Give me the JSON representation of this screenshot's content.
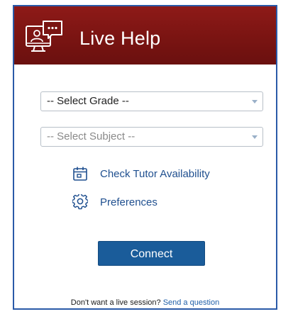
{
  "header": {
    "title": "Live Help",
    "icon": "live-help-chat-icon",
    "background_color": "#7a1412"
  },
  "form": {
    "grade_select": {
      "value": "-- Select Grade --",
      "enabled": true
    },
    "subject_select": {
      "value": "-- Select Subject --",
      "enabled": false
    }
  },
  "links": {
    "tutor_availability": {
      "label": "Check Tutor Availability",
      "icon": "calendar-icon"
    },
    "preferences": {
      "label": "Preferences",
      "icon": "gear-icon"
    }
  },
  "connect_button": {
    "label": "Connect",
    "color": "#1a5c9a"
  },
  "footer": {
    "prompt": "Don't want a live session? ",
    "link_label": "Send a question",
    "link_color": "#1f5fa8"
  }
}
